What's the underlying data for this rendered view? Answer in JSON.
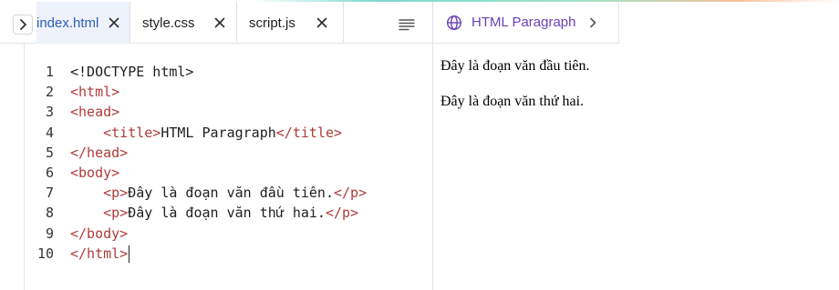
{
  "editor": {
    "tabs": [
      {
        "label": "index.html",
        "active": true
      },
      {
        "label": "style.css",
        "active": false
      },
      {
        "label": "script.js",
        "active": false
      }
    ],
    "line_numbers": [
      "1",
      "2",
      "3",
      "4",
      "5",
      "6",
      "7",
      "8",
      "9",
      "10"
    ],
    "code": {
      "l1": {
        "text": "<!DOCTYPE html>"
      },
      "l2": {
        "tag": "<html>"
      },
      "l3": {
        "tag": "<head>"
      },
      "l4": {
        "indent": "    ",
        "open": "<title>",
        "text": "HTML Paragraph",
        "close": "</title>"
      },
      "l5": {
        "tag": "</head>"
      },
      "l6": {
        "tag": "<body>"
      },
      "l7": {
        "indent": "    ",
        "open": "<p>",
        "text": "Đây là đoạn văn đầu tiên.",
        "close": "</p>"
      },
      "l8": {
        "indent": "    ",
        "open": "<p>",
        "text": "Đây là đoạn văn thứ hai.",
        "close": "</p>"
      },
      "l9": {
        "tag": "</body>"
      },
      "l10": {
        "tag": "</html>"
      }
    }
  },
  "preview": {
    "title": "HTML Paragraph",
    "paragraphs": [
      "Đây là đoạn văn đầu tiên.",
      "Đây là đoạn văn thứ hai."
    ]
  },
  "colors": {
    "tag": "#b03a3a",
    "active_tab_text": "#2f5fb8",
    "preview_title": "#6a3fb8"
  },
  "icons": {
    "collapse": "chevron-right-icon",
    "close": "close-icon",
    "format": "align-lines-icon",
    "globe": "globe-icon",
    "preview_chevron": "chevron-right-icon"
  }
}
